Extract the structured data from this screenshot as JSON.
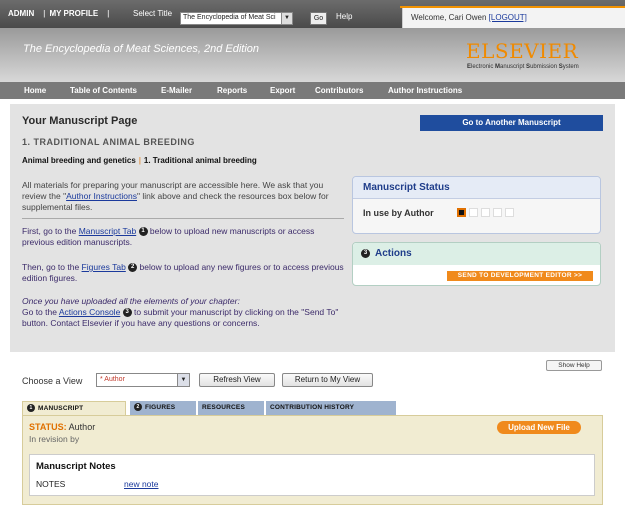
{
  "topbar": {
    "admin": "ADMIN",
    "my_profile": "MY PROFILE",
    "select_title_label": "Select Title",
    "title_select_value": "The Encyclopedia of Meat Sci",
    "go_label": "Go",
    "help_label": "Help",
    "welcome": "Welcome, Cari Owen",
    "logout": "[LOGOUT]"
  },
  "header": {
    "publication_title": "The Encyclopedia of Meat Sciences, 2nd Edition",
    "logo": "ELSEVIER",
    "ems_parts": [
      "E",
      "lectronic ",
      "M",
      "anuscript ",
      "S",
      "ubmission ",
      "S",
      "ystem"
    ]
  },
  "nav": {
    "items": [
      "Home",
      "Table of Contents",
      "E-Mailer",
      "Reports",
      "Export",
      "Contributors",
      "Author Instructions"
    ]
  },
  "main": {
    "page_title": "Your Manuscript Page",
    "section_title": "1. TRADITIONAL ANIMAL BREEDING",
    "breadcrumb_parent": "Animal breeding and genetics",
    "breadcrumb_current": "1. Traditional animal breeding",
    "another_button": "Go to Another Manuscript",
    "intro_before": "All materials for preparing your manuscript are accessible here. We ask that you review the \"",
    "intro_link": "Author Instructions",
    "intro_after": "\" link above and check the resources box below for supplemental files.",
    "step1_before": "First, go to the ",
    "step1_link": "Manuscript Tab",
    "step1_num": "1",
    "step1_after": " below to upload new manuscripts or access previous edition manuscripts.",
    "step2_before": "Then, go to the ",
    "step2_link": "Figures Tab",
    "step2_num": "2",
    "step2_after": " below to upload any new figures or to access previous edition figures.",
    "step3_italic": "Once you have uploaded all the elements of your chapter:",
    "step3_before": "Go to the ",
    "step3_link": "Actions Console",
    "step3_num": "3",
    "step3_after": " to submit your manuscript by clicking on the \"Send To\" button. Contact Elsevier if you have any questions or concerns."
  },
  "status_box": {
    "title": "Manuscript Status",
    "in_use": "In use by Author"
  },
  "actions_box": {
    "num": "3",
    "title": "Actions",
    "send_button": "SEND TO DEVELOPMENT EDITOR >>"
  },
  "lower": {
    "show_help": "Show Help",
    "choose_view_label": "Choose a View",
    "view_value": "* Author",
    "refresh_button": "Refresh View",
    "return_button": "Return to My View",
    "tabs": [
      {
        "num": "1",
        "label": "MANUSCRIPT"
      },
      {
        "num": "2",
        "label": "FIGURES"
      },
      {
        "num": "",
        "label": "RESOURCES"
      },
      {
        "num": "",
        "label": "CONTRIBUTION HISTORY"
      }
    ],
    "status_label": "STATUS:",
    "status_value": " Author",
    "revision": "In revision by",
    "upload_button": "Upload New File",
    "notes_title": "Manuscript Notes",
    "notes_label": "NOTES",
    "new_note": "new note"
  },
  "colors": {
    "accent_orange": "#f08a1c",
    "brand_blue": "#1f4d9e",
    "nav_gray": "#7a7a7a"
  }
}
